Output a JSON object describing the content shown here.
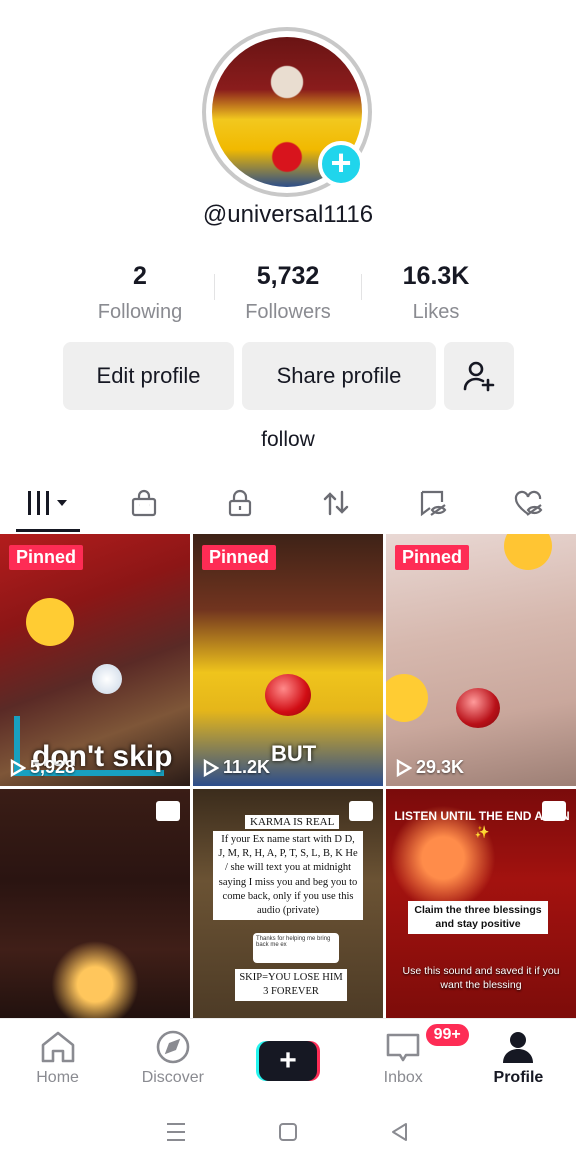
{
  "profile": {
    "username": "@universal1116",
    "bio": "follow"
  },
  "stats": [
    {
      "value": "2",
      "label": "Following"
    },
    {
      "value": "5,732",
      "label": "Followers"
    },
    {
      "value": "16.3K",
      "label": "Likes"
    }
  ],
  "buttons": {
    "edit": "Edit profile",
    "share": "Share profile"
  },
  "tabs": [
    "videos-icon",
    "shop-bag-icon",
    "lock-icon",
    "repost-icon",
    "favorites-icon",
    "liked-icon"
  ],
  "grid": [
    {
      "pinned": "Pinned",
      "views": "5,928",
      "caption": "don't skip"
    },
    {
      "pinned": "Pinned",
      "views": "11.2K",
      "caption": "BUT"
    },
    {
      "pinned": "Pinned",
      "views": "29.3K"
    },
    {
      "type": "photo"
    },
    {
      "type": "photo",
      "title": "KARMA IS REAL",
      "body": "If your Ex name start with D D, J, M, R, H, A, P, T, S, L, B, K He / she will text you at midnight saying I miss you and beg you to come back, only if you use this audio (private)",
      "note": "Thanks for helping me bring back me ex",
      "skip": "SKIP=YOU LOSE HIM 3 FOREVER"
    },
    {
      "type": "photo",
      "headline": "LISTEN UNTIL THE END AMEN ✨",
      "claim": "Claim the three blessings and stay positive",
      "footer": "Use this sound and saved it if you want the blessing"
    }
  ],
  "nav": {
    "home": "Home",
    "discover": "Discover",
    "inbox": "Inbox",
    "inbox_badge": "99+",
    "profile": "Profile"
  },
  "colors": {
    "accent": "#fe2c55",
    "cyan": "#20d5ec",
    "text": "#161823",
    "muted": "#8a8b91"
  }
}
